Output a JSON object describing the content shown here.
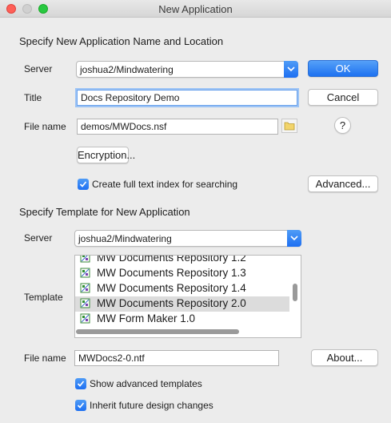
{
  "window": {
    "title": "New Application"
  },
  "app_section": {
    "heading": "Specify New Application Name and Location",
    "server_label": "Server",
    "server_value": "joshua2/Mindwatering",
    "title_label": "Title",
    "title_value": "Docs Repository Demo",
    "filename_label": "File name",
    "filename_value": "demos/MWDocs.nsf",
    "encryption_label": "Encryption...",
    "fulltext_label": "Create full text index for searching",
    "fulltext_checked": true,
    "advanced_label": "Advanced..."
  },
  "buttons": {
    "ok_label": "OK",
    "cancel_label": "Cancel",
    "help_label": "?"
  },
  "template_section": {
    "heading": "Specify Template for New Application",
    "server_label": "Server",
    "server_value": "joshua2/Mindwatering",
    "template_label": "Template",
    "templates": [
      "MW Documents Repository 1.2",
      "MW Documents Repository 1.3",
      "MW Documents Repository 1.4",
      "MW Documents Repository 2.0",
      "MW Form Maker 1.0"
    ],
    "selected_index": 3,
    "filename_label": "File name",
    "filename_value": "MWDocs2-0.ntf",
    "about_label": "About...",
    "show_advanced_label": "Show advanced templates",
    "show_advanced_checked": true,
    "inherit_label": "Inherit future design changes",
    "inherit_checked": true
  },
  "colors": {
    "accent": "#1d6ff2",
    "selection": "#dcdcdc"
  }
}
